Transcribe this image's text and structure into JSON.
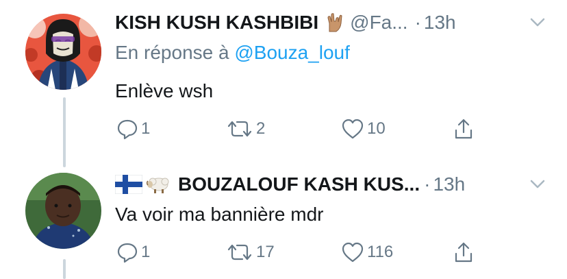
{
  "tweets": [
    {
      "name": "KISH KUSH KASHBIBI",
      "name_emoji": "hand-gesture-emoji-icon",
      "handle": "@Fa...",
      "dot": "·",
      "time": "13h",
      "reply_prefix": "En réponse à",
      "reply_mention": "@Bouza_louf",
      "text": "Enlève wsh",
      "reply_count": "1",
      "retweet_count": "2",
      "like_count": "10"
    },
    {
      "name": "BOUZALOUF KASH KUS...",
      "name_prefix_icons": [
        "finland-flag-icon",
        "sheep-emoji-icon"
      ],
      "dot": "·",
      "time": "13h",
      "text": "Va voir ma bannière mdr",
      "reply_count": "1",
      "retweet_count": "17",
      "like_count": "116"
    }
  ],
  "colors": {
    "text": "#14171a",
    "secondary": "#657786",
    "link": "#1da1f2",
    "thread_line": "#ccd6dd"
  }
}
